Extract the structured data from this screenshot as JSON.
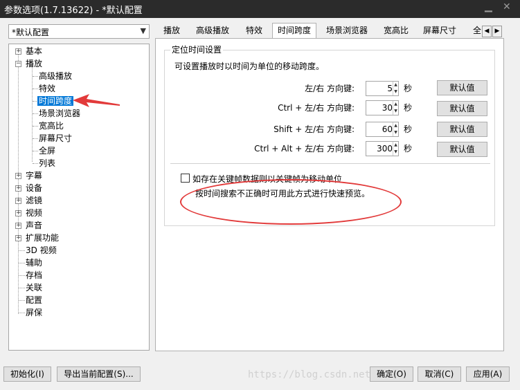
{
  "window": {
    "title": "参数选项(1.7.13622) - *默认配置"
  },
  "profile_combo": {
    "value": "*默认配置"
  },
  "tree": {
    "nodes": [
      {
        "label": "基本"
      },
      {
        "label": "播放"
      },
      {
        "label": "高级播放"
      },
      {
        "label": "特效"
      },
      {
        "label": "时间跨度",
        "selected": true
      },
      {
        "label": "场景浏览器"
      },
      {
        "label": "宽高比"
      },
      {
        "label": "屏幕尺寸"
      },
      {
        "label": "全屏"
      },
      {
        "label": "列表"
      },
      {
        "label": "字幕"
      },
      {
        "label": "设备"
      },
      {
        "label": "滤镜"
      },
      {
        "label": "视频"
      },
      {
        "label": "声音"
      },
      {
        "label": "扩展功能"
      },
      {
        "label": "3D 视频"
      },
      {
        "label": "辅助"
      },
      {
        "label": "存档"
      },
      {
        "label": "关联"
      },
      {
        "label": "配置"
      },
      {
        "label": "屏保"
      }
    ]
  },
  "tabs": [
    "播放",
    "高级播放",
    "特效",
    "时间跨度",
    "场景浏览器",
    "宽高比",
    "屏幕尺寸",
    "全"
  ],
  "group": {
    "title": "定位时间设置",
    "description": "可设置播放时以时间为单位的移动跨度。",
    "rows": [
      {
        "label": "左/右 方向键:",
        "value": "5",
        "unit": "秒",
        "button": "默认值"
      },
      {
        "label": "Ctrl + 左/右 方向键:",
        "value": "30",
        "unit": "秒",
        "button": "默认值"
      },
      {
        "label": "Shift + 左/右 方向键:",
        "value": "60",
        "unit": "秒",
        "button": "默认值"
      },
      {
        "label": "Ctrl + Alt + 左/右 方向键:",
        "value": "300",
        "unit": "秒",
        "button": "默认值"
      }
    ],
    "checkbox_label": "如存在关键帧数据则以关键帧为移动单位",
    "checkbox_note": "按时间搜索不正确时可用此方式进行快速预览。"
  },
  "buttons": {
    "init": "初始化(I)",
    "export": "导出当前配置(S)...",
    "ok": "确定(O)",
    "cancel": "取消(C)",
    "apply": "应用(A)"
  },
  "watermark": "https://blog.csdn.net/...",
  "colors": {
    "annotation": "#e23a3a",
    "selection": "#0078d7"
  }
}
